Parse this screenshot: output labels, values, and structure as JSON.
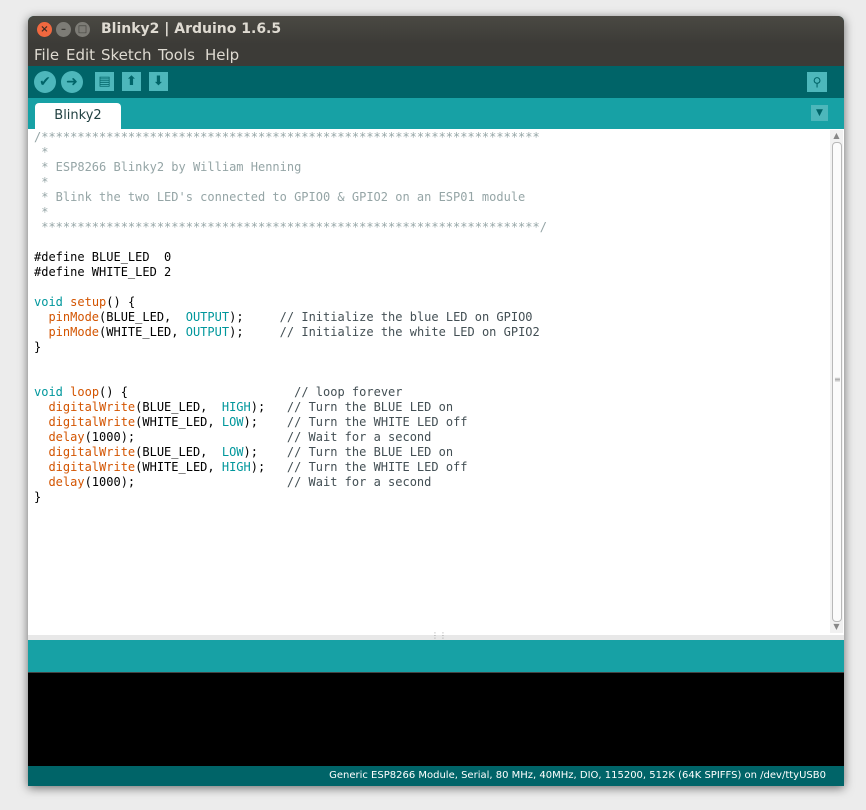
{
  "window": {
    "title": "Blinky2 | Arduino 1.6.5",
    "controls": {
      "close": "×",
      "minimize": "–",
      "maximize": "□"
    }
  },
  "menu": {
    "items": [
      {
        "label": "File"
      },
      {
        "label": "Edit"
      },
      {
        "label": "Sketch"
      },
      {
        "label": "Tools"
      },
      {
        "label": "Help"
      }
    ]
  },
  "toolbar": {
    "verify_icon": "✔",
    "upload_icon": "➜",
    "new_icon": "▤",
    "open_icon": "⬆",
    "save_icon": "⬇",
    "serial_monitor_icon": "⚲"
  },
  "tabs": {
    "active": "Blinky2",
    "menu_icon": "▼"
  },
  "editor": {
    "lines": [
      [
        {
          "t": "/*********************************************************************",
          "c": "cmt"
        }
      ],
      [
        {
          "t": " *",
          "c": "cmt"
        }
      ],
      [
        {
          "t": " * ESP8266 Blinky2 by William Henning",
          "c": "cmt"
        }
      ],
      [
        {
          "t": " *",
          "c": "cmt"
        }
      ],
      [
        {
          "t": " * Blink the two LED's connected to GPIO0 & GPIO2 on an ESP01 module",
          "c": "cmt"
        }
      ],
      [
        {
          "t": " *",
          "c": "cmt"
        }
      ],
      [
        {
          "t": " *********************************************************************/",
          "c": "cmt"
        }
      ],
      [],
      [
        {
          "t": "#define BLUE_LED  0",
          "c": ""
        }
      ],
      [
        {
          "t": "#define WHITE_LED 2",
          "c": ""
        }
      ],
      [],
      [
        {
          "t": "void",
          "c": "kw"
        },
        {
          "t": " ",
          "c": ""
        },
        {
          "t": "setup",
          "c": "fn"
        },
        {
          "t": "() {",
          "c": ""
        }
      ],
      [
        {
          "t": "  ",
          "c": ""
        },
        {
          "t": "pinMode",
          "c": "fn"
        },
        {
          "t": "(BLUE_LED,  ",
          "c": ""
        },
        {
          "t": "OUTPUT",
          "c": "const"
        },
        {
          "t": ");     ",
          "c": ""
        },
        {
          "t": "// Initialize the blue LED on GPIO0",
          "c": "cmt2"
        }
      ],
      [
        {
          "t": "  ",
          "c": ""
        },
        {
          "t": "pinMode",
          "c": "fn"
        },
        {
          "t": "(WHITE_LED, ",
          "c": ""
        },
        {
          "t": "OUTPUT",
          "c": "const"
        },
        {
          "t": ");     ",
          "c": ""
        },
        {
          "t": "// Initialize the white LED on GPIO2",
          "c": "cmt2"
        }
      ],
      [
        {
          "t": "}",
          "c": ""
        }
      ],
      [],
      [],
      [
        {
          "t": "void",
          "c": "kw"
        },
        {
          "t": " ",
          "c": ""
        },
        {
          "t": "loop",
          "c": "fn"
        },
        {
          "t": "() {                       ",
          "c": ""
        },
        {
          "t": "// loop forever",
          "c": "cmt2"
        }
      ],
      [
        {
          "t": "  ",
          "c": ""
        },
        {
          "t": "digitalWrite",
          "c": "fn"
        },
        {
          "t": "(BLUE_LED,  ",
          "c": ""
        },
        {
          "t": "HIGH",
          "c": "const"
        },
        {
          "t": ");   ",
          "c": ""
        },
        {
          "t": "// Turn the BLUE LED on",
          "c": "cmt2"
        }
      ],
      [
        {
          "t": "  ",
          "c": ""
        },
        {
          "t": "digitalWrite",
          "c": "fn"
        },
        {
          "t": "(WHITE_LED, ",
          "c": ""
        },
        {
          "t": "LOW",
          "c": "const"
        },
        {
          "t": ");    ",
          "c": ""
        },
        {
          "t": "// Turn the WHITE LED off",
          "c": "cmt2"
        }
      ],
      [
        {
          "t": "  ",
          "c": ""
        },
        {
          "t": "delay",
          "c": "fn"
        },
        {
          "t": "(1000);                     ",
          "c": ""
        },
        {
          "t": "// Wait for a second",
          "c": "cmt2"
        }
      ],
      [
        {
          "t": "  ",
          "c": ""
        },
        {
          "t": "digitalWrite",
          "c": "fn"
        },
        {
          "t": "(BLUE_LED,  ",
          "c": ""
        },
        {
          "t": "LOW",
          "c": "const"
        },
        {
          "t": ");    ",
          "c": ""
        },
        {
          "t": "// Turn the BLUE LED on",
          "c": "cmt2"
        }
      ],
      [
        {
          "t": "  ",
          "c": ""
        },
        {
          "t": "digitalWrite",
          "c": "fn"
        },
        {
          "t": "(WHITE_LED, ",
          "c": ""
        },
        {
          "t": "HIGH",
          "c": "const"
        },
        {
          "t": ");   ",
          "c": ""
        },
        {
          "t": "// Turn the WHITE LED off",
          "c": "cmt2"
        }
      ],
      [
        {
          "t": "  ",
          "c": ""
        },
        {
          "t": "delay",
          "c": "fn"
        },
        {
          "t": "(1000);                     ",
          "c": ""
        },
        {
          "t": "// Wait for a second",
          "c": "cmt2"
        }
      ],
      [
        {
          "t": "}",
          "c": ""
        }
      ]
    ]
  },
  "status": {
    "board_info": "Generic ESP8266 Module, Serial, 80 MHz, 40MHz, DIO, 115200, 512K (64K SPIFFS) on /dev/ttyUSB0"
  }
}
